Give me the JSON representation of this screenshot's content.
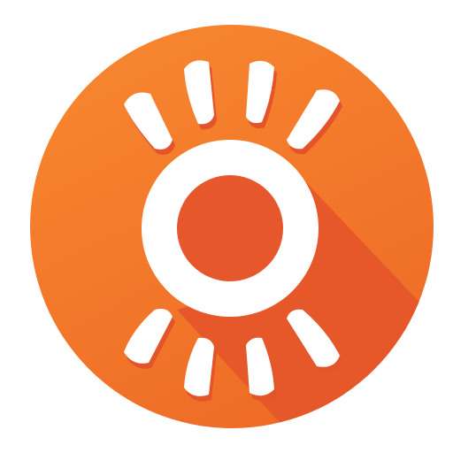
{
  "icon": {
    "name": "orange-eye-lens-logo",
    "colors": {
      "circle_top": "#F7862F",
      "circle_bottom": "#EE6A26",
      "shadow": "#E4542A",
      "pupil": "#E6572B",
      "white": "#FFFFFF"
    }
  }
}
